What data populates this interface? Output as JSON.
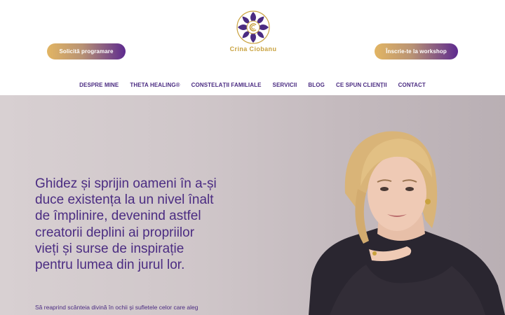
{
  "brand": {
    "name": "Crina Ciobanu",
    "colors": {
      "purple": "#4b2c82",
      "gold": "#c9a23f"
    }
  },
  "header": {
    "left_button": "Solicită programare",
    "right_button": "Înscrie-te la workshop"
  },
  "nav": {
    "items": [
      "DESPRE MINE",
      "THETA HEALING®",
      "CONSTELAȚII FAMILIALE",
      "SERVICII",
      "BLOG",
      "CE SPUN CLIENȚII",
      "CONTACT"
    ]
  },
  "hero": {
    "headline": "Ghidez și sprijin oameni în a-și duce existența la un nivel înalt de împlinire, devenind astfel creatorii deplini ai propriilor vieți și surse de inspirație pentru lumea din jurul lor.",
    "subtext": "Să reaprind scânteia divină în ochii și sufletele celor care aleg"
  }
}
